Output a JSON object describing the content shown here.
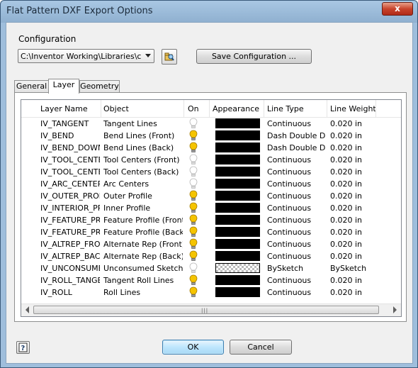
{
  "window": {
    "title": "Flat Pattern DXF Export Options",
    "close_label": "x"
  },
  "configuration": {
    "label": "Configuration",
    "selected_value": "C:\\Inventor Working\\Libraries\\confi",
    "save_label": "Save Configuration ..."
  },
  "tabs": [
    {
      "label": "General",
      "active": false
    },
    {
      "label": "Layer",
      "active": true
    },
    {
      "label": "Geometry",
      "active": false
    }
  ],
  "table": {
    "columns": [
      "Layer Name",
      "Object",
      "On",
      "Appearance",
      "Line Type",
      "Line Weight"
    ],
    "rows": [
      {
        "layer": "IV_TANGENT",
        "object": "Tangent Lines",
        "on": false,
        "appearance": "black",
        "line_type": "Continuous",
        "line_weight": "0.020 in"
      },
      {
        "layer": "IV_BEND",
        "object": "Bend Lines (Front)",
        "on": true,
        "appearance": "black",
        "line_type": "Dash Double Dot",
        "line_weight": "0.020 in"
      },
      {
        "layer": "IV_BEND_DOWN",
        "object": "Bend Lines (Back)",
        "on": true,
        "appearance": "black",
        "line_type": "Dash Double Dot",
        "line_weight": "0.020 in"
      },
      {
        "layer": "IV_TOOL_CENTER",
        "object": "Tool Centers (Front)",
        "on": false,
        "appearance": "black",
        "line_type": "Continuous",
        "line_weight": "0.020 in"
      },
      {
        "layer": "IV_TOOL_CENTER_DOWN",
        "object": "Tool Centers (Back)",
        "on": false,
        "appearance": "black",
        "line_type": "Continuous",
        "line_weight": "0.020 in"
      },
      {
        "layer": "IV_ARC_CENTERS",
        "object": "Arc Centers",
        "on": false,
        "appearance": "black",
        "line_type": "Continuous",
        "line_weight": "0.020 in"
      },
      {
        "layer": "IV_OUTER_PROFILE",
        "object": "Outer Profile",
        "on": true,
        "appearance": "black",
        "line_type": "Continuous",
        "line_weight": "0.020 in"
      },
      {
        "layer": "IV_INTERIOR_PROFILES",
        "object": "Inner Profile",
        "on": true,
        "appearance": "black",
        "line_type": "Continuous",
        "line_weight": "0.020 in"
      },
      {
        "layer": "IV_FEATURE_PROFILES",
        "object": "Feature Profile (Front)",
        "on": true,
        "appearance": "black",
        "line_type": "Continuous",
        "line_weight": "0.020 in"
      },
      {
        "layer": "IV_FEATURE_PROFILES_DOWN",
        "object": "Feature Profile (Back)",
        "on": true,
        "appearance": "black",
        "line_type": "Continuous",
        "line_weight": "0.020 in"
      },
      {
        "layer": "IV_ALTREP_FRONT",
        "object": "Alternate Rep (Front)",
        "on": true,
        "appearance": "black",
        "line_type": "Continuous",
        "line_weight": "0.020 in"
      },
      {
        "layer": "IV_ALTREP_BACK",
        "object": "Alternate Rep (Back)",
        "on": true,
        "appearance": "black",
        "line_type": "Continuous",
        "line_weight": "0.020 in"
      },
      {
        "layer": "IV_UNCONSUMED_SKETCHES",
        "object": "Unconsumed Sketches",
        "on": false,
        "appearance": "by-sketch",
        "line_type": "BySketch",
        "line_weight": "BySketch"
      },
      {
        "layer": "IV_ROLL_TANGENT",
        "object": "Tangent Roll Lines",
        "on": true,
        "appearance": "black",
        "line_type": "Continuous",
        "line_weight": "0.020 in"
      },
      {
        "layer": "IV_ROLL",
        "object": "Roll Lines",
        "on": true,
        "appearance": "black",
        "line_type": "Continuous",
        "line_weight": "0.020 in"
      }
    ]
  },
  "buttons": {
    "ok_label": "OK",
    "cancel_label": "Cancel"
  },
  "colors": {
    "accent": "#3c7fb1",
    "bulb_on": "#f5c400",
    "title_bar": "#a9c7e3"
  }
}
